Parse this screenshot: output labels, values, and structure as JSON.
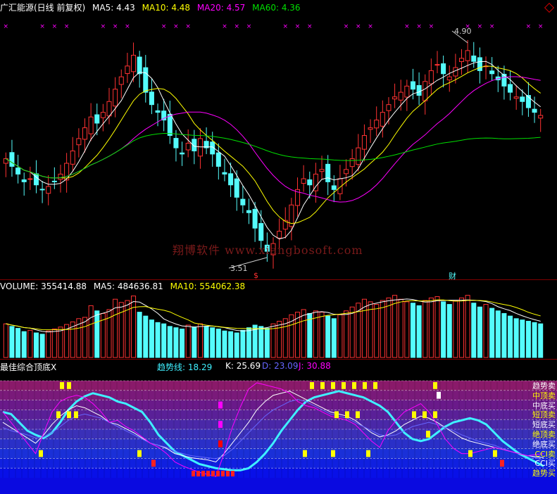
{
  "price_header": {
    "name": "广汇能源(日线 前复权)",
    "ma5": "MA5: 4.43",
    "ma10": "MA10: 4.48",
    "ma20": "MA20: 4.57",
    "ma60": "MA60: 4.36"
  },
  "volume_header": {
    "volume": "VOLUME: 355414.88",
    "ma5": "MA5: 484636.81",
    "ma10": "MA10: 554062.38"
  },
  "indicator_header": {
    "name": "最佳综合顶底X",
    "trend": "趋势线: 18.29",
    "k": "K: 25.69",
    "d": "D: 23.09",
    "j": "J: 30.88"
  },
  "watermark": "翔博软件 www.xiangbosoft.com",
  "annotations": {
    "high": "4.90",
    "low": "3.51",
    "dollar": "$",
    "cai": "财"
  },
  "band_labels": [
    "趋势卖",
    "中顶卖",
    "中底买",
    "短顶卖",
    "短底买",
    "绝顶卖",
    "绝底买",
    "CCI卖",
    "CCI买",
    "趋势买"
  ],
  "colors": {
    "up": "#ff3232",
    "down": "#54fcfc",
    "ma5": "#ffffff",
    "ma10": "#ffff00",
    "ma20": "#ff00ff",
    "ma60": "#00e000",
    "trend": "#3ff0ff",
    "k": "#ffffff",
    "d": "#6666ff",
    "j": "#ff00ff"
  },
  "chart_data": [
    {
      "type": "candlestick",
      "title": "广汇能源(日线 前复权)",
      "ylim": [
        3.4,
        5.05
      ],
      "high_label": 4.9,
      "low_label": 3.51,
      "closes": [
        4.15,
        4.1,
        4.05,
        4.0,
        4.02,
        3.98,
        3.95,
        3.97,
        4.0,
        4.05,
        4.12,
        4.2,
        4.28,
        4.35,
        4.42,
        4.38,
        4.45,
        4.52,
        4.6,
        4.68,
        4.75,
        4.82,
        4.7,
        4.58,
        4.5,
        4.45,
        4.4,
        4.3,
        4.22,
        4.18,
        4.25,
        4.2,
        4.28,
        4.22,
        4.18,
        4.1,
        4.05,
        3.98,
        3.9,
        3.85,
        3.8,
        3.7,
        3.62,
        3.55,
        3.6,
        3.68,
        3.75,
        3.85,
        3.95,
        4.02,
        3.98,
        4.05,
        4.08,
        4.0,
        3.95,
        4.02,
        4.08,
        4.15,
        4.22,
        4.3,
        4.35,
        4.4,
        4.45,
        4.5,
        4.55,
        4.58,
        4.62,
        4.6,
        4.56,
        4.65,
        4.72,
        4.76,
        4.7,
        4.68,
        4.74,
        4.8,
        4.85,
        4.78,
        4.72,
        4.75,
        4.7,
        4.66,
        4.62,
        4.58,
        4.55,
        4.52,
        4.48,
        4.45,
        4.43
      ]
    },
    {
      "type": "bar",
      "title": "VOLUME",
      "values": [
        52,
        48,
        45,
        40,
        42,
        38,
        36,
        41,
        44,
        47,
        51,
        55,
        60,
        62,
        80,
        72,
        68,
        74,
        90,
        85,
        88,
        95,
        70,
        64,
        58,
        54,
        52,
        48,
        46,
        44,
        50,
        47,
        52,
        48,
        46,
        44,
        41,
        40,
        38,
        42,
        46,
        50,
        48,
        45,
        52,
        56,
        60,
        66,
        70,
        74,
        68,
        72,
        70,
        64,
        60,
        66,
        72,
        78,
        84,
        90,
        86,
        82,
        88,
        92,
        96,
        90,
        86,
        84,
        80,
        88,
        92,
        94,
        86,
        82,
        88,
        92,
        96,
        84,
        78,
        82,
        76,
        72,
        68,
        64,
        60,
        58,
        56,
        54,
        52
      ],
      "ylim": [
        0,
        100
      ]
    },
    {
      "type": "line",
      "title": "最佳综合顶底X",
      "series": [
        {
          "name": "趋势线",
          "values": [
            70,
            68,
            60,
            52,
            48,
            45,
            50,
            60,
            72,
            80,
            85,
            88,
            86,
            84,
            80,
            78,
            74,
            70,
            60,
            48,
            40,
            32,
            28,
            24,
            20,
            18,
            16,
            15,
            14,
            14,
            16,
            22,
            30,
            40,
            52,
            62,
            72,
            80,
            84,
            86,
            88,
            90,
            88,
            86,
            84,
            80,
            76,
            70,
            60,
            50,
            44,
            42,
            44,
            50,
            56,
            60,
            62,
            64,
            62,
            58,
            50,
            42,
            36,
            30,
            26,
            22,
            18
          ]
        },
        {
          "name": "K",
          "values": [
            60,
            55,
            50,
            45,
            40,
            48,
            58,
            66,
            72,
            76,
            74,
            70,
            66,
            60,
            58,
            54,
            50,
            45,
            40,
            38,
            35,
            30,
            28,
            26,
            25,
            24,
            22,
            30,
            40,
            50,
            60,
            72,
            80,
            86,
            88,
            90,
            86,
            82,
            78,
            74,
            70,
            68,
            66,
            62,
            56,
            50,
            46,
            48,
            52,
            58,
            62,
            66,
            64,
            60,
            55,
            50,
            45,
            42,
            40,
            38,
            36,
            34,
            32,
            30,
            28,
            27,
            26
          ]
        },
        {
          "name": "D",
          "values": [
            55,
            52,
            50,
            48,
            45,
            46,
            50,
            56,
            62,
            66,
            68,
            66,
            64,
            60,
            56,
            52,
            48,
            44,
            40,
            38,
            36,
            32,
            30,
            28,
            27,
            26,
            25,
            28,
            34,
            42,
            50,
            58,
            66,
            72,
            76,
            80,
            82,
            80,
            76,
            72,
            68,
            66,
            64,
            60,
            56,
            52,
            48,
            47,
            48,
            52,
            56,
            58,
            60,
            58,
            55,
            52,
            48,
            45,
            42,
            40,
            38,
            35,
            32,
            30,
            28,
            26,
            23
          ]
        },
        {
          "name": "J",
          "values": [
            70,
            60,
            50,
            40,
            30,
            50,
            70,
            80,
            84,
            86,
            84,
            78,
            70,
            60,
            62,
            56,
            52,
            46,
            40,
            36,
            30,
            22,
            18,
            15,
            12,
            10,
            8,
            30,
            55,
            75,
            92,
            98,
            96,
            94,
            92,
            88,
            80,
            76,
            74,
            70,
            66,
            64,
            62,
            58,
            50,
            42,
            36,
            52,
            62,
            70,
            74,
            78,
            70,
            58,
            44,
            35,
            30,
            30,
            32,
            34,
            36,
            34,
            32,
            30,
            28,
            29,
            30
          ]
        }
      ],
      "ylim": [
        0,
        100
      ]
    }
  ]
}
